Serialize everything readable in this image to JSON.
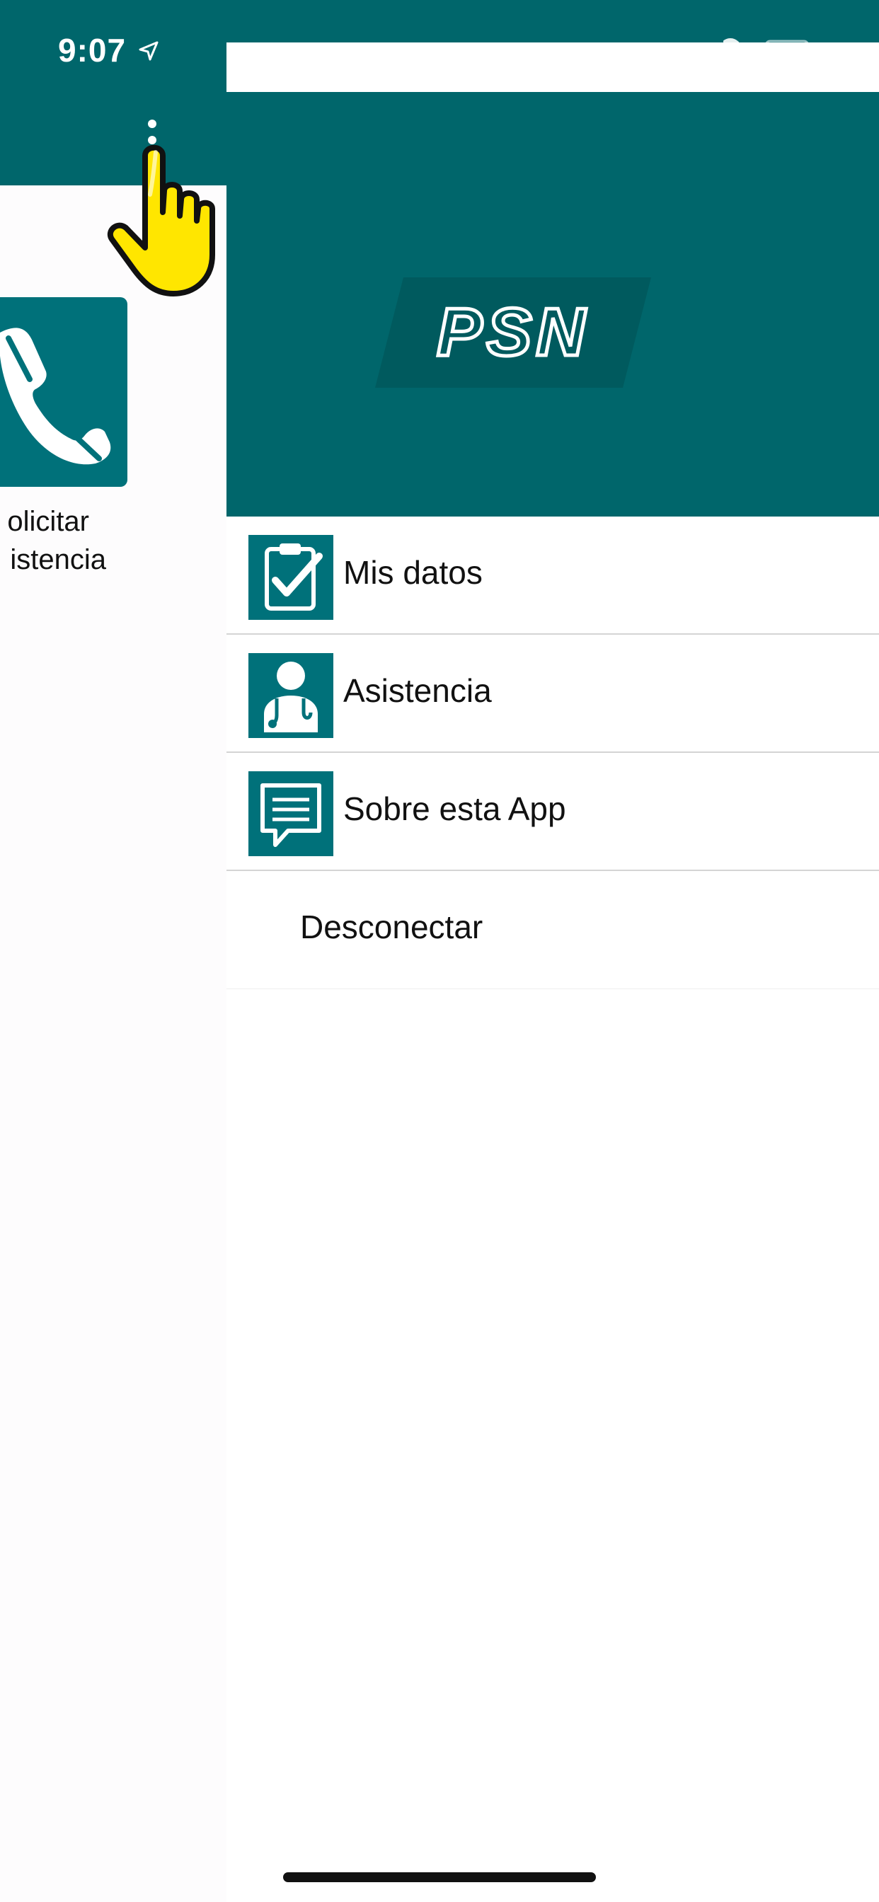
{
  "status_bar": {
    "time": "9:07"
  },
  "background_screen": {
    "tile": {
      "label_line1": "olicitar",
      "label_line2": "istencia"
    }
  },
  "drawer": {
    "logo_text": "PSN",
    "menu": [
      {
        "label": "Mis datos",
        "icon": "clipboard-check-icon"
      },
      {
        "label": "Asistencia",
        "icon": "doctor-icon"
      },
      {
        "label": "Sobre esta App",
        "icon": "chat-bubble-icon"
      },
      {
        "label": "Desconectar",
        "icon": ""
      }
    ]
  },
  "colors": {
    "primary": "#00666b",
    "icon_tile": "#00717a",
    "divider": "#d4d4d4",
    "cursor": "#ffe600"
  }
}
